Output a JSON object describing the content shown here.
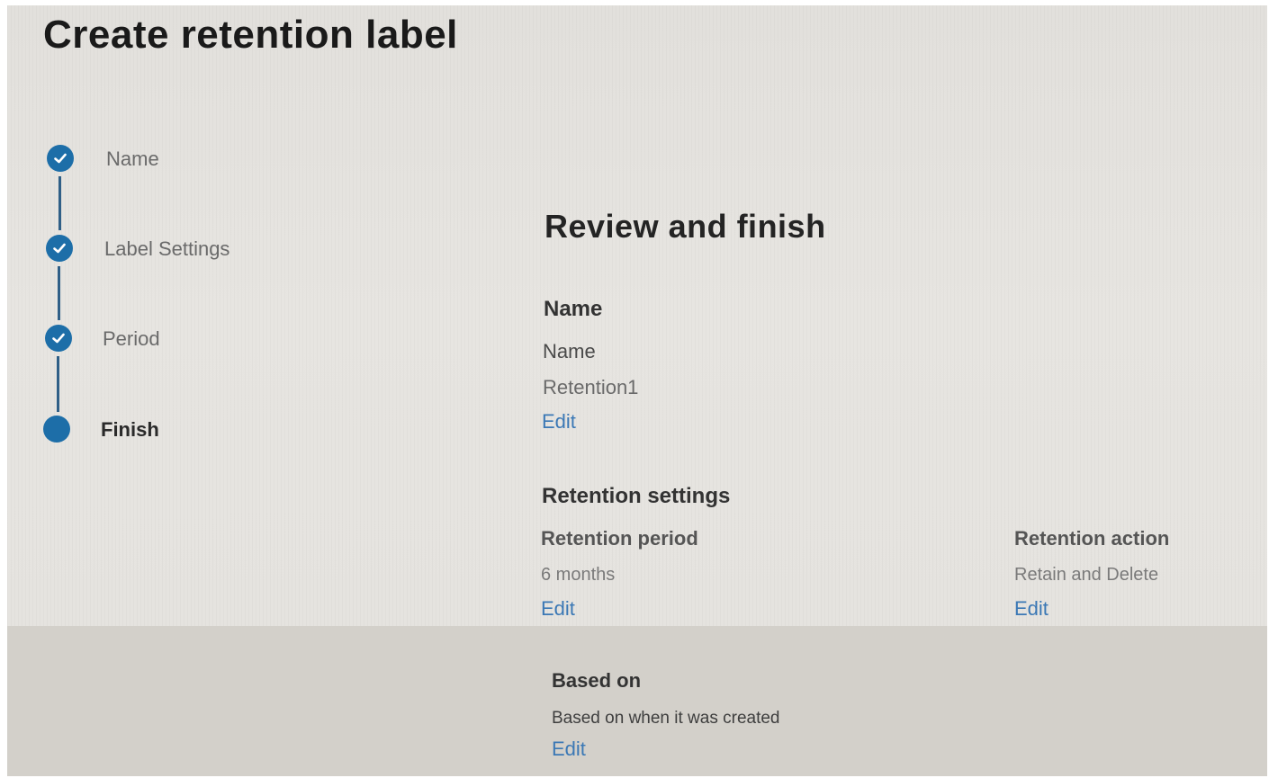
{
  "page": {
    "title": "Create retention label"
  },
  "steps": [
    {
      "label": "Name",
      "state": "completed"
    },
    {
      "label": "Label Settings",
      "state": "completed"
    },
    {
      "label": "Period",
      "state": "completed"
    },
    {
      "label": "Finish",
      "state": "current"
    }
  ],
  "review": {
    "title": "Review and finish",
    "name_section": {
      "heading": "Name",
      "label": "Name",
      "value": "Retention1",
      "edit": "Edit"
    },
    "retention_settings": {
      "heading": "Retention settings",
      "period": {
        "label": "Retention period",
        "value": "6 months",
        "edit": "Edit"
      },
      "action": {
        "label": "Retention action",
        "value": "Retain and Delete",
        "edit": "Edit"
      }
    },
    "based_on": {
      "heading": "Based on",
      "value": "Based on when it was created",
      "edit": "Edit"
    }
  },
  "colors": {
    "step_accent": "#1d6ea8",
    "link": "#3b78b5",
    "title": "#1a1a1a"
  },
  "icons": {
    "completed_step": "checkmark-icon",
    "current_step": "filled-circle-icon"
  }
}
